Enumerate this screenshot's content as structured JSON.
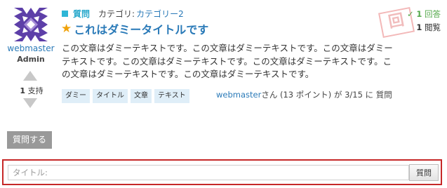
{
  "question": {
    "type_label": "質問",
    "category_prefix": "カテゴリ:",
    "category": "カテゴリー2",
    "title": "これはダミータイトルです",
    "body": "この文章はダミーテキストです。この文章はダミーテキストです。この文章はダミーテキストです。この文章はダミーテキストです。この文章はダミーテキストです。この文章はダミーテキストです。この文章はダミーテキストです。",
    "tags": [
      "ダミー",
      "タイトル",
      "文章",
      "テキスト"
    ],
    "asked_by": "webmaster",
    "asked_suffix": "さん (13 ポイント) が 3/15 に 質問",
    "answer_count": "1",
    "answer_label": "回答",
    "view_count": "1",
    "view_label": "閲覧",
    "answered_stamp": "回"
  },
  "user": {
    "name": "webmaster",
    "role": "Admin"
  },
  "votes": {
    "count": "1",
    "label": "支持"
  },
  "ask_button_label": "質問する",
  "ask_form": {
    "placeholder": "タイトル:",
    "value": "",
    "submit_label": "質問"
  },
  "colors": {
    "link": "#2a7ab8",
    "type_accent": "#2eb6d6",
    "star": "#f0a20a",
    "answer_green": "#53a84a",
    "tag_bg": "#dfeef8",
    "form_border": "#c62828",
    "avatar_bg": "#5d3fa8"
  },
  "icons": {
    "star": "star-icon",
    "check": "check-icon",
    "vote_up": "arrow-up-icon",
    "vote_down": "arrow-down-icon"
  }
}
